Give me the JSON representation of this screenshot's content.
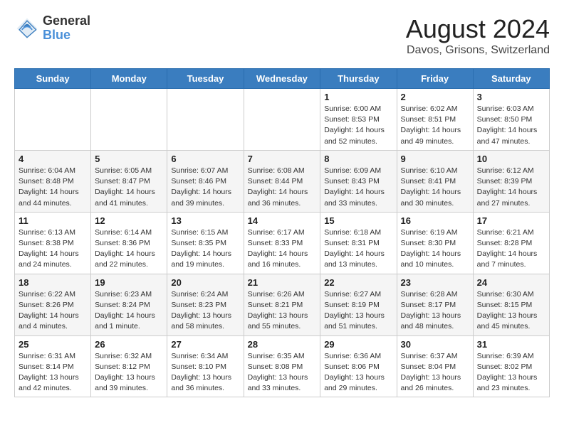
{
  "logo": {
    "general": "General",
    "blue": "Blue"
  },
  "title": "August 2024",
  "subtitle": "Davos, Grisons, Switzerland",
  "headers": [
    "Sunday",
    "Monday",
    "Tuesday",
    "Wednesday",
    "Thursday",
    "Friday",
    "Saturday"
  ],
  "weeks": [
    [
      {
        "day": "",
        "info": ""
      },
      {
        "day": "",
        "info": ""
      },
      {
        "day": "",
        "info": ""
      },
      {
        "day": "",
        "info": ""
      },
      {
        "day": "1",
        "info": "Sunrise: 6:00 AM\nSunset: 8:53 PM\nDaylight: 14 hours and 52 minutes."
      },
      {
        "day": "2",
        "info": "Sunrise: 6:02 AM\nSunset: 8:51 PM\nDaylight: 14 hours and 49 minutes."
      },
      {
        "day": "3",
        "info": "Sunrise: 6:03 AM\nSunset: 8:50 PM\nDaylight: 14 hours and 47 minutes."
      }
    ],
    [
      {
        "day": "4",
        "info": "Sunrise: 6:04 AM\nSunset: 8:48 PM\nDaylight: 14 hours and 44 minutes."
      },
      {
        "day": "5",
        "info": "Sunrise: 6:05 AM\nSunset: 8:47 PM\nDaylight: 14 hours and 41 minutes."
      },
      {
        "day": "6",
        "info": "Sunrise: 6:07 AM\nSunset: 8:46 PM\nDaylight: 14 hours and 39 minutes."
      },
      {
        "day": "7",
        "info": "Sunrise: 6:08 AM\nSunset: 8:44 PM\nDaylight: 14 hours and 36 minutes."
      },
      {
        "day": "8",
        "info": "Sunrise: 6:09 AM\nSunset: 8:43 PM\nDaylight: 14 hours and 33 minutes."
      },
      {
        "day": "9",
        "info": "Sunrise: 6:10 AM\nSunset: 8:41 PM\nDaylight: 14 hours and 30 minutes."
      },
      {
        "day": "10",
        "info": "Sunrise: 6:12 AM\nSunset: 8:39 PM\nDaylight: 14 hours and 27 minutes."
      }
    ],
    [
      {
        "day": "11",
        "info": "Sunrise: 6:13 AM\nSunset: 8:38 PM\nDaylight: 14 hours and 24 minutes."
      },
      {
        "day": "12",
        "info": "Sunrise: 6:14 AM\nSunset: 8:36 PM\nDaylight: 14 hours and 22 minutes."
      },
      {
        "day": "13",
        "info": "Sunrise: 6:15 AM\nSunset: 8:35 PM\nDaylight: 14 hours and 19 minutes."
      },
      {
        "day": "14",
        "info": "Sunrise: 6:17 AM\nSunset: 8:33 PM\nDaylight: 14 hours and 16 minutes."
      },
      {
        "day": "15",
        "info": "Sunrise: 6:18 AM\nSunset: 8:31 PM\nDaylight: 14 hours and 13 minutes."
      },
      {
        "day": "16",
        "info": "Sunrise: 6:19 AM\nSunset: 8:30 PM\nDaylight: 14 hours and 10 minutes."
      },
      {
        "day": "17",
        "info": "Sunrise: 6:21 AM\nSunset: 8:28 PM\nDaylight: 14 hours and 7 minutes."
      }
    ],
    [
      {
        "day": "18",
        "info": "Sunrise: 6:22 AM\nSunset: 8:26 PM\nDaylight: 14 hours and 4 minutes."
      },
      {
        "day": "19",
        "info": "Sunrise: 6:23 AM\nSunset: 8:24 PM\nDaylight: 14 hours and 1 minute."
      },
      {
        "day": "20",
        "info": "Sunrise: 6:24 AM\nSunset: 8:23 PM\nDaylight: 13 hours and 58 minutes."
      },
      {
        "day": "21",
        "info": "Sunrise: 6:26 AM\nSunset: 8:21 PM\nDaylight: 13 hours and 55 minutes."
      },
      {
        "day": "22",
        "info": "Sunrise: 6:27 AM\nSunset: 8:19 PM\nDaylight: 13 hours and 51 minutes."
      },
      {
        "day": "23",
        "info": "Sunrise: 6:28 AM\nSunset: 8:17 PM\nDaylight: 13 hours and 48 minutes."
      },
      {
        "day": "24",
        "info": "Sunrise: 6:30 AM\nSunset: 8:15 PM\nDaylight: 13 hours and 45 minutes."
      }
    ],
    [
      {
        "day": "25",
        "info": "Sunrise: 6:31 AM\nSunset: 8:14 PM\nDaylight: 13 hours and 42 minutes."
      },
      {
        "day": "26",
        "info": "Sunrise: 6:32 AM\nSunset: 8:12 PM\nDaylight: 13 hours and 39 minutes."
      },
      {
        "day": "27",
        "info": "Sunrise: 6:34 AM\nSunset: 8:10 PM\nDaylight: 13 hours and 36 minutes."
      },
      {
        "day": "28",
        "info": "Sunrise: 6:35 AM\nSunset: 8:08 PM\nDaylight: 13 hours and 33 minutes."
      },
      {
        "day": "29",
        "info": "Sunrise: 6:36 AM\nSunset: 8:06 PM\nDaylight: 13 hours and 29 minutes."
      },
      {
        "day": "30",
        "info": "Sunrise: 6:37 AM\nSunset: 8:04 PM\nDaylight: 13 hours and 26 minutes."
      },
      {
        "day": "31",
        "info": "Sunrise: 6:39 AM\nSunset: 8:02 PM\nDaylight: 13 hours and 23 minutes."
      }
    ]
  ]
}
